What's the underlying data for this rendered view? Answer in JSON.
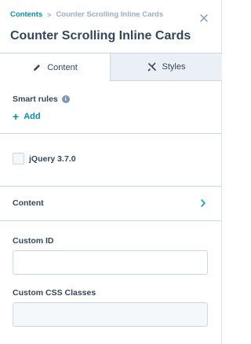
{
  "header": {
    "breadcrumb_root": "Contents",
    "breadcrumb_separator": ">",
    "breadcrumb_current": "Counter Scrolling Inline Cards",
    "title": "Counter Scrolling Inline Cards",
    "close_icon": "close-icon"
  },
  "tabs": [
    {
      "label": "Content",
      "icon": "pencil-icon",
      "active": true
    },
    {
      "label": "Styles",
      "icon": "paintbrush-icon",
      "active": false
    }
  ],
  "smart_rules": {
    "label": "Smart rules",
    "info_glyph": "i",
    "add_plus": "+",
    "add_label": "Add"
  },
  "jquery": {
    "label": "jQuery 3.7.0",
    "checked": false
  },
  "content_section": {
    "label": "Content"
  },
  "fields": {
    "custom_id": {
      "label": "Custom ID",
      "value": ""
    },
    "custom_css": {
      "label": "Custom CSS Classes",
      "value": ""
    }
  },
  "colors": {
    "link": "#0091ae",
    "text": "#33475b",
    "border": "#cbd6e2",
    "muted": "#99afc4",
    "inactive_tab": "#eaf0f6"
  }
}
